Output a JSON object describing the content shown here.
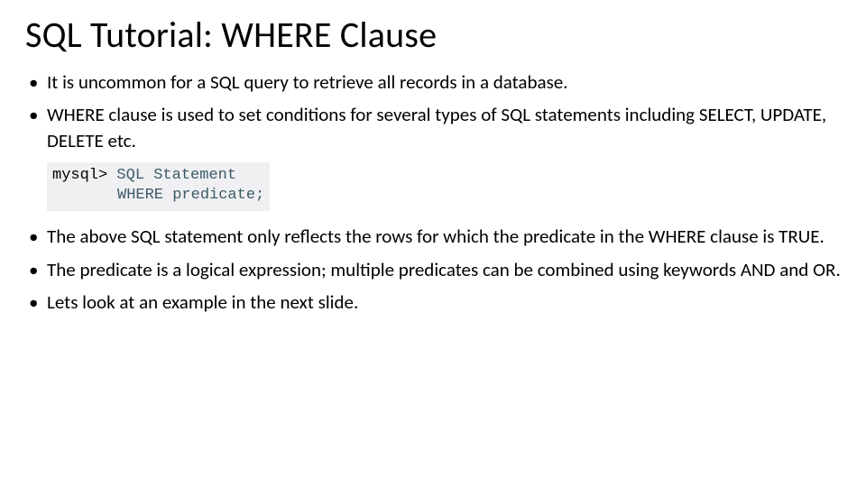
{
  "title": "SQL Tutorial: WHERE Clause",
  "bullets_top": [
    "It is uncommon for a SQL query to retrieve all records in a database.",
    "WHERE clause is used to set conditions for several types of SQL statements including SELECT, UPDATE, DELETE etc."
  ],
  "code": {
    "prompt": "mysql>",
    "line1": "SQL Statement",
    "line2": "WHERE predicate;"
  },
  "bullets_bottom": [
    "The above SQL statement only reflects the rows for which the predicate in the WHERE clause is TRUE.",
    "The predicate is a logical expression; multiple predicates can be combined using keywords AND and OR.",
    "Lets look at an example in the next slide."
  ]
}
